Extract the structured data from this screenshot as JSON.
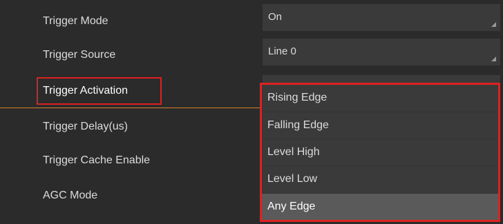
{
  "settings": {
    "trigger_mode": {
      "label": "Trigger Mode",
      "value": "On"
    },
    "trigger_source": {
      "label": "Trigger Source",
      "value": "Line 0"
    },
    "trigger_activation": {
      "label": "Trigger Activation"
    },
    "trigger_delay": {
      "label": "Trigger Delay(us)"
    },
    "trigger_cache_enable": {
      "label": "Trigger Cache Enable"
    },
    "agc_mode": {
      "label": "AGC Mode"
    }
  },
  "dropdown": {
    "options": [
      "Rising Edge",
      "Falling Edge",
      "Level High",
      "Level Low",
      "Any Edge"
    ],
    "hovered": "Any Edge"
  },
  "colors": {
    "background": "#2b2b2b",
    "field": "#3a3a3a",
    "highlight_box": "#e02020",
    "selected_row_line": "#d9822b"
  }
}
